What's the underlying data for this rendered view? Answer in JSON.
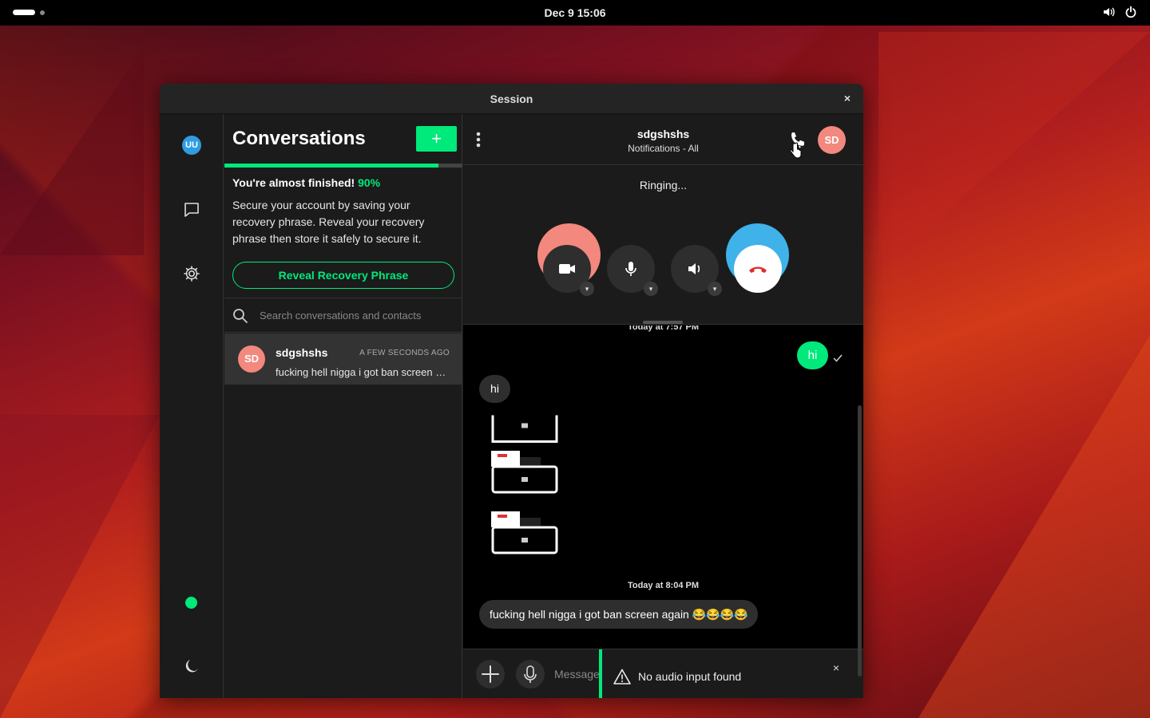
{
  "system": {
    "clock": "Dec 9  15:06",
    "tray_icons": [
      "volume-icon",
      "power-icon"
    ]
  },
  "window": {
    "title": "Session",
    "close_label": "×"
  },
  "rail": {
    "user_initials": "UU",
    "icons": [
      "conversations-icon",
      "settings-icon",
      "moon-icon"
    ],
    "status_color": "#00e97b"
  },
  "conversations": {
    "heading": "Conversations",
    "new_label": "+",
    "progress": 0.9,
    "onboarding": {
      "headline": "You're almost finished!",
      "percent": "90%",
      "body": "Secure your account by saving your recovery phrase. Reveal your recovery phrase then store it safely to secure it.",
      "button": "Reveal Recovery Phrase"
    },
    "search_placeholder": "Search conversations and contacts",
    "items": [
      {
        "initials": "SD",
        "name": "sdgshshs",
        "time": "A FEW SECONDS AGO",
        "preview": "fucking hell nigga i got ban screen again 😂😂😂😂"
      }
    ]
  },
  "chat": {
    "name": "sdgshshs",
    "subtitle": "Notifications - All",
    "avatar_initials": "SD",
    "call": {
      "status": "Ringing...",
      "caret": "▾"
    },
    "messages": {
      "date1": "Today at 7:57 PM",
      "outgoing": "hi",
      "incoming": "hi",
      "date2": "Today at 8:04 PM",
      "incoming_long": "fucking hell nigga i got ban screen again 😂😂😂😂"
    },
    "toast": {
      "message": "No audio input found",
      "close": "×"
    },
    "composer_placeholder": "Message"
  },
  "colors": {
    "accent": "#00e97b",
    "peer_avatar": "#f3887e",
    "self_avatar": "#3fb2ea",
    "hangup": "#e02b2b"
  }
}
